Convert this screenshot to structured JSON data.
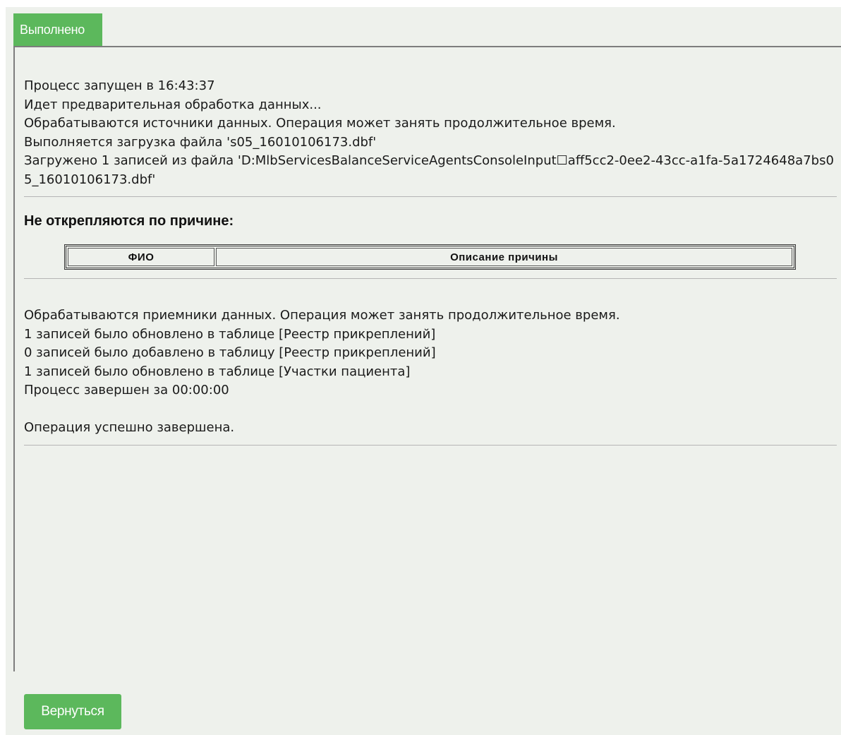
{
  "tab": {
    "label": "Выполнено"
  },
  "log_top": {
    "lines": [
      "Процесс запущен в 16:43:37",
      "Идет предварительная обработка данных...",
      "Обрабатываются источники данных. Операция может занять продолжительное время.",
      "Выполняется загрузка файла 's05_16010106173.dbf'",
      "Загружено 1 записей из файла 'D:MlbServicesBalanceServiceAgentsConsoleInput☐aff5cc2-0ee2-43cc-a1fa-5a1724648a7bs05_16010106173.dbf'"
    ]
  },
  "section": {
    "title": "Не открепляются по причине:"
  },
  "table": {
    "columns": [
      "ФИО",
      "Описание причины"
    ],
    "rows": []
  },
  "log_bottom": {
    "lines": [
      "Обрабатываются приемники данных. Операция может занять продолжительное время.",
      "1 записей было обновлено в таблице [Реестр прикреплений]",
      "0 записей было добавлено в таблицу [Реестр прикреплений]",
      "1 записей было обновлено в таблице [Участки пациента]",
      "Процесс завершен за 00:00:00",
      "",
      "Операция успешно завершена."
    ]
  },
  "buttons": {
    "back_label": "Вернуться"
  },
  "colors": {
    "accent": "#5cb85c",
    "background": "#eef1ec"
  }
}
